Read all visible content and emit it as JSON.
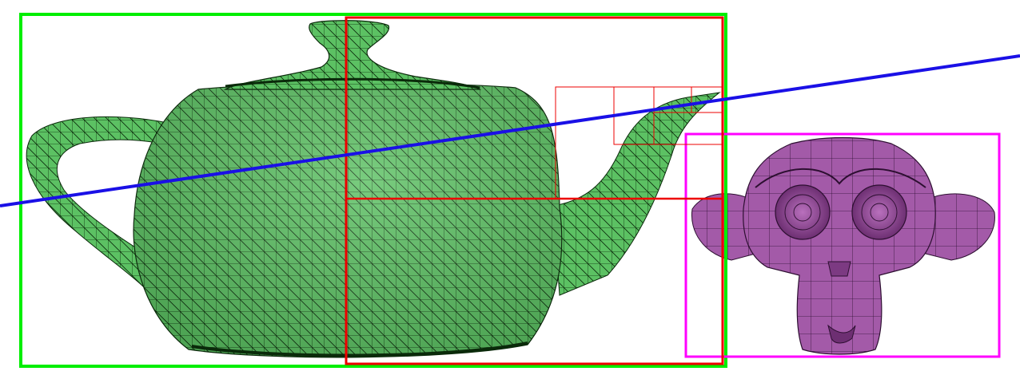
{
  "scene": {
    "objects": [
      {
        "name": "teapot",
        "fill": "#5cc163",
        "wire": "#0a2a0a",
        "bbox_color": "#00ee00"
      },
      {
        "name": "monkey",
        "fill": "#a35aa8",
        "wire": "#2d0f31",
        "bbox_color": "#ff00ff"
      }
    ],
    "ray_color": "#1a10e6",
    "bvh_color": "#ee0000"
  }
}
